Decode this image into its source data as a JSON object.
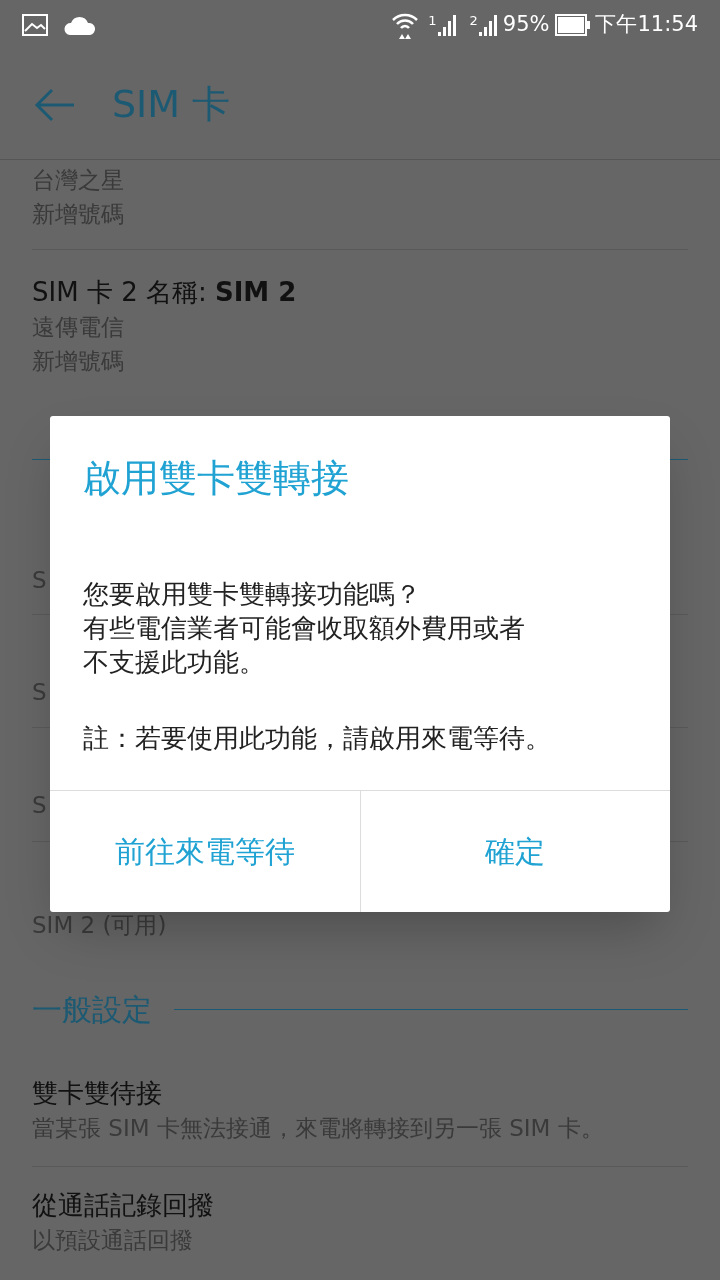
{
  "status_bar": {
    "sim_labels": [
      "1",
      "2"
    ],
    "battery": "95%",
    "time": "下午11:54"
  },
  "toolbar": {
    "title": "SIM 卡"
  },
  "sections": [
    {
      "rule": false,
      "items": [
        {
          "lines": [
            "台灣之星",
            "新增號碼"
          ]
        },
        {
          "title": "SIM 卡 2 名稱: **SIM 2**",
          "lines": [
            "遠傳電信",
            "新增號碼"
          ]
        }
      ]
    },
    {
      "rule": true,
      "items": [
        {
          "lines": [
            "S"
          ]
        },
        {
          "lines": [
            "S"
          ]
        },
        {
          "lines": [
            "S"
          ]
        },
        {
          "lines": [
            "SIM 2 (可用)"
          ]
        }
      ]
    },
    {
      "rule": true,
      "heading": "一般設定",
      "items": [
        {
          "title": "雙卡雙待接",
          "lines": [
            "當某張 SIM 卡無法接通，來電將轉接到另一張 SIM 卡。"
          ]
        },
        {
          "title": "從通話記錄回撥",
          "lines": [
            "以預設通話回撥"
          ]
        }
      ]
    }
  ],
  "dialog": {
    "title": "啟用雙卡雙轉接",
    "paragraphs": [
      {
        "lines": [
          "您要啟用雙卡雙轉接功能嗎？",
          "有些電信業者可能會收取額外費用或者",
          "不支援此功能。"
        ]
      },
      {
        "lines": [
          "註：若要使用此功能，請啟用來電等待。"
        ]
      }
    ],
    "buttons": [
      "前往來電等待",
      "確定"
    ]
  }
}
